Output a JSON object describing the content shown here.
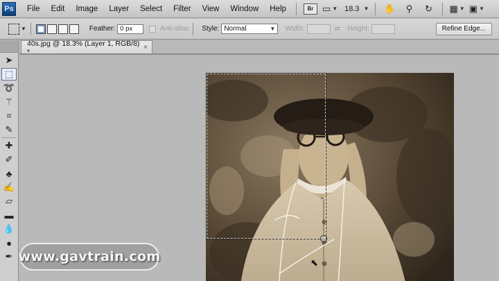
{
  "app": {
    "logo": "Ps"
  },
  "menu": [
    "File",
    "Edit",
    "Image",
    "Layer",
    "Select",
    "Filter",
    "View",
    "Window",
    "Help"
  ],
  "menubar": {
    "bridge_label": "Br",
    "zoom": "18.3"
  },
  "options": {
    "feather_label": "Feather:",
    "feather_value": "0 px",
    "antialias_label": "Anti-alias",
    "style_label": "Style:",
    "style_value": "Normal",
    "width_label": "Width:",
    "height_label": "Height:",
    "refine_label": "Refine Edge..."
  },
  "document": {
    "tab_title": "40s.jpg @ 18.3% (Layer 1, RGB/8) *",
    "close": "×"
  },
  "watermark": "www.gavtrain.com",
  "colors": {
    "ui_bg": "#b9b9b9",
    "photo_dark": "#3e3326",
    "photo_light": "#d9cbb1"
  }
}
